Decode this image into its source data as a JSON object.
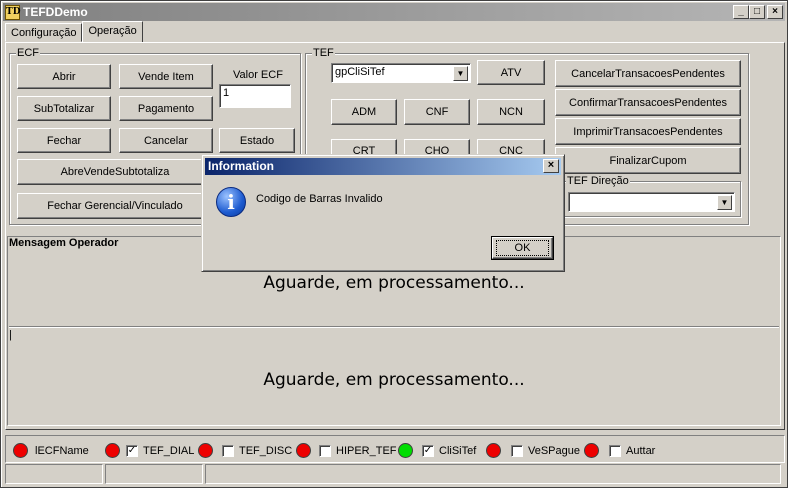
{
  "window": {
    "title": "TEFDDemo",
    "icon_text": "TD",
    "min": "_",
    "max": "□",
    "close": "×"
  },
  "tabs": [
    {
      "label": "Configuração"
    },
    {
      "label": "Operação"
    }
  ],
  "ecf": {
    "group_label": "ECF",
    "abrir": "Abrir",
    "vende_item": "Vende Item",
    "valor_ecf_label": "Valor ECF",
    "valor_ecf_value": "1",
    "subtotalizar": "SubTotalizar",
    "pagamento": "Pagamento",
    "fechar": "Fechar",
    "cancelar": "Cancelar",
    "estado": "Estado",
    "abre_vende": "AbreVendeSubtotaliza",
    "fechar_gerencial": "Fechar Gerencial/Vinculado"
  },
  "tef": {
    "group_label": "TEF",
    "gp_value": "gpCliSiTef",
    "atv": "ATV",
    "cancelar_pend": "CancelarTransacoesPendentes",
    "adm": "ADM",
    "cnf": "CNF",
    "ncn": "NCN",
    "confirmar_pend": "ConfirmarTransacoesPendentes",
    "crt": "CRT",
    "cho": "CHQ",
    "cnc": "CNC",
    "imprimir_pend": "ImprimirTransacoesPendentes",
    "finalizar": "FinalizarCupom",
    "direcao_label": "TEF Direção",
    "direcao_value": ""
  },
  "mensagem": {
    "title": "Mensagem Operador",
    "operador_text": "Aguarde, em processamento...",
    "cliente_text": "Aguarde, em processamento...",
    "cursor": "|"
  },
  "status": {
    "items": [
      {
        "label": "lECFName",
        "led": "#ee0000",
        "check": null
      },
      {
        "label": "TEF_DIAL",
        "led": "#ee0000",
        "check": "✓"
      },
      {
        "label": "TEF_DISC",
        "led": "#ee0000",
        "check": ""
      },
      {
        "label": "HIPER_TEF",
        "led": "#ee0000",
        "check": ""
      },
      {
        "label": "CliSiTef",
        "led": "#00dd00",
        "check": "✓"
      },
      {
        "label": "VeSPague",
        "led": "#ee0000",
        "check": ""
      },
      {
        "label": "Auttar",
        "led": "#ee0000",
        "check": ""
      }
    ]
  },
  "dialog": {
    "title": "Information",
    "close": "×",
    "icon": "i",
    "message": "Codigo de Barras Invalido",
    "ok": "OK"
  },
  "colors": {
    "title_inactive": "#808080",
    "dialog_title": "#0a246a",
    "face": "#d4d0c8"
  }
}
